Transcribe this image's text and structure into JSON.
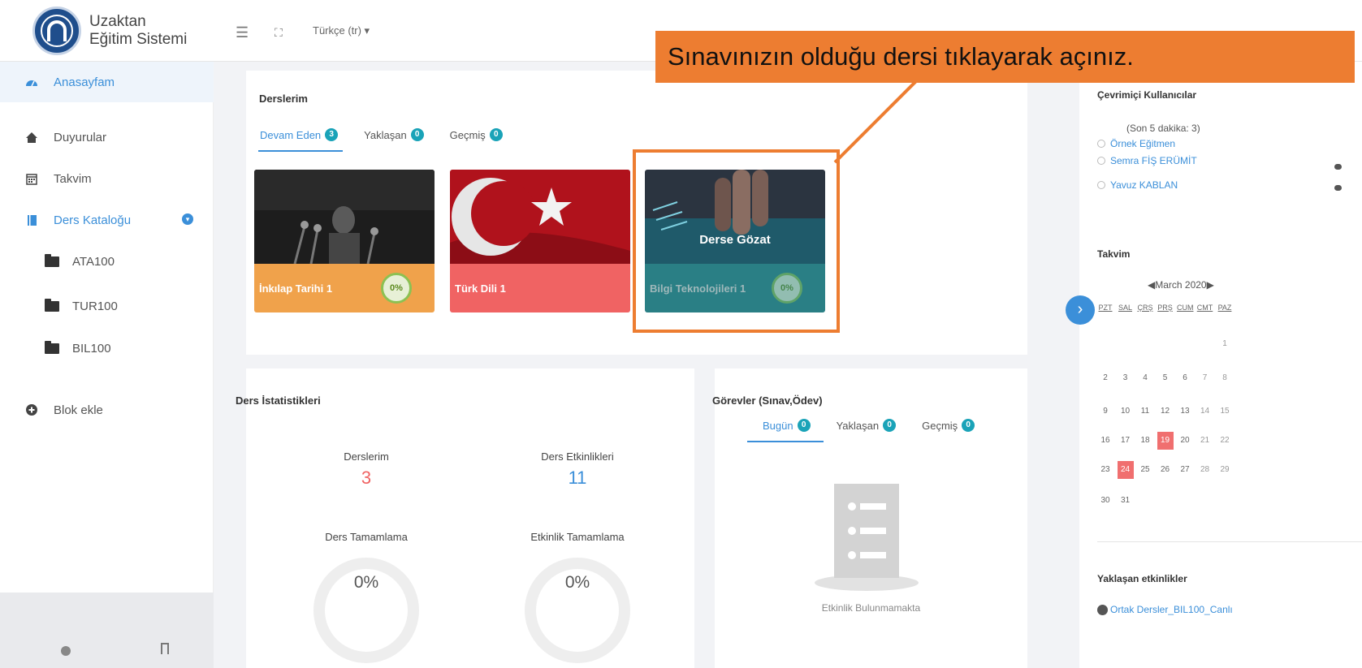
{
  "header": {
    "logo_line1": "Uzaktan",
    "logo_line2": "Eğitim Sistemi",
    "language": "Türkçe (tr) ▾",
    "menu_icon": "hamburger-icon",
    "fullscreen_icon": "fullscreen-icon"
  },
  "sidebar": {
    "items": [
      {
        "label": "Anasayfam",
        "icon": "dashboard-icon"
      },
      {
        "label": "Duyurular",
        "icon": "home-icon"
      },
      {
        "label": "Takvim",
        "icon": "calendar-icon"
      },
      {
        "label": "Ders Kataloğu",
        "icon": "book-icon"
      }
    ],
    "courses": [
      "ATA100",
      "TUR100",
      "BIL100"
    ],
    "add_block": "Blok ekle"
  },
  "courses_card": {
    "title": "Derslerim",
    "tabs": [
      {
        "label": "Devam Eden",
        "count": "3"
      },
      {
        "label": "Yaklaşan",
        "count": "0"
      },
      {
        "label": "Geçmiş",
        "count": "0"
      }
    ],
    "courses": [
      {
        "name": "İnkılap Tarihi 1",
        "progress": "0%"
      },
      {
        "name": "Türk Dili 1",
        "progress": ""
      },
      {
        "name": "Bilgi Teknolojileri 1",
        "progress": "0%",
        "hover_label": "Derse Gözat"
      }
    ]
  },
  "stats_card": {
    "title": "Ders İstatistikleri",
    "courses_label": "Derslerim",
    "courses_value": "3",
    "activities_label": "Ders Etkinlikleri",
    "activities_value": "11",
    "course_completion_label": "Ders Tamamlama",
    "course_completion_value": "0%",
    "activity_completion_label": "Etkinlik Tamamlama",
    "activity_completion_value": "0%"
  },
  "tasks_card": {
    "title": "Görevler (Sınav,Ödev)",
    "tabs": [
      {
        "label": "Bugün",
        "count": "0"
      },
      {
        "label": "Yaklaşan",
        "count": "0"
      },
      {
        "label": "Geçmiş",
        "count": "0"
      }
    ],
    "empty_text": "Etkinlik Bulunmamakta"
  },
  "online_users": {
    "title": "Çevrimiçi Kullanıcılar",
    "subtitle": "(Son 5 dakika: 3)",
    "users": [
      "Örnek Eğitmen",
      "Semra FİŞ ERÜMİT",
      "Yavuz KABLAN"
    ]
  },
  "calendar": {
    "title": "Takvim",
    "month": "◀March 2020▶",
    "days": [
      "PZT",
      "SAL",
      "ÇRŞ",
      "PRŞ",
      "CUM",
      "CMT",
      "PAZ"
    ],
    "weeks": [
      [
        "",
        "",
        "",
        "",
        "",
        "",
        "1"
      ],
      [
        "2",
        "3",
        "4",
        "5",
        "6",
        "7",
        "8"
      ],
      [
        "9",
        "10",
        "11",
        "12",
        "13",
        "14",
        "15"
      ],
      [
        "16",
        "17",
        "18",
        "19",
        "20",
        "21",
        "22"
      ],
      [
        "23",
        "24",
        "25",
        "26",
        "27",
        "28",
        "29"
      ],
      [
        "30",
        "31",
        "",
        "",
        "",
        "",
        ""
      ]
    ],
    "highlighted": [
      "19",
      "24"
    ]
  },
  "upcoming": {
    "title": "Yaklaşan etkinlikler",
    "first_item": "Ortak Dersler_BIL100_Canlı"
  },
  "annotation": {
    "text": "Sınavınızın olduğu dersi tıklayarak açınız."
  },
  "colors": {
    "accent": "#3b8fd9",
    "badge": "#1aa3b8",
    "orange": "#ed7d31",
    "course1": "#f0a24b",
    "course2": "#f06363",
    "course3": "#2a7f85"
  }
}
